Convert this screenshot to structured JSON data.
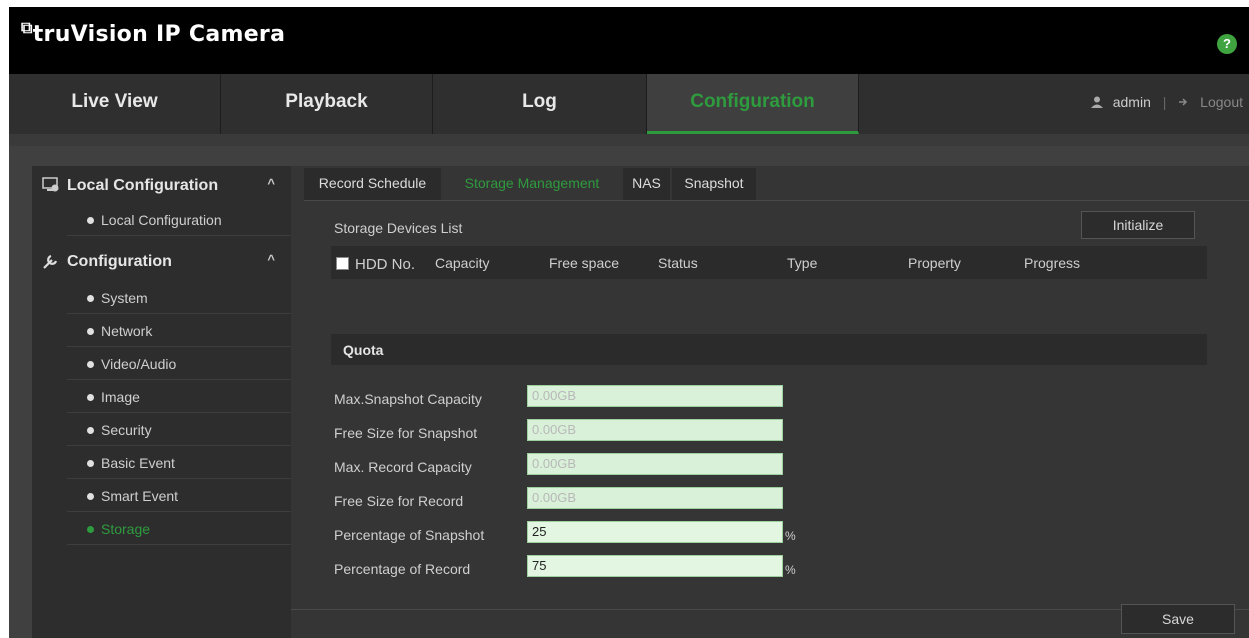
{
  "header": {
    "brand_mark": "⧉",
    "brand": "truVision IP Camera",
    "help_icon": "?"
  },
  "nav": {
    "tabs": [
      {
        "label": "Live View"
      },
      {
        "label": "Playback"
      },
      {
        "label": "Log"
      },
      {
        "label": "Configuration",
        "active": true
      }
    ],
    "user": "admin",
    "separator": "|",
    "logout": "Logout"
  },
  "sidebar": {
    "local_section": {
      "label": "Local Configuration",
      "caret": "^",
      "items": [
        {
          "label": "Local Configuration"
        }
      ]
    },
    "config_section": {
      "label": "Configuration",
      "caret": "^",
      "items": [
        {
          "label": "System"
        },
        {
          "label": "Network"
        },
        {
          "label": "Video/Audio"
        },
        {
          "label": "Image"
        },
        {
          "label": "Security"
        },
        {
          "label": "Basic Event"
        },
        {
          "label": "Smart Event"
        },
        {
          "label": "Storage",
          "active": true
        }
      ]
    }
  },
  "tabs": [
    {
      "label": "Record Schedule"
    },
    {
      "label": "Storage Management",
      "active": true
    },
    {
      "label": "NAS"
    },
    {
      "label": "Snapshot"
    }
  ],
  "storage": {
    "title": "Storage Devices List",
    "initialize_label": "Initialize",
    "columns": {
      "hdd": "HDD No.",
      "capacity": "Capacity",
      "free": "Free space",
      "status": "Status",
      "type": "Type",
      "property": "Property",
      "progress": "Progress"
    }
  },
  "quota": {
    "title": "Quota",
    "fields": [
      {
        "label": "Max.Snapshot Capacity",
        "value": "0.00GB",
        "editable": false
      },
      {
        "label": "Free Size for Snapshot",
        "value": "0.00GB",
        "editable": false
      },
      {
        "label": "Max. Record Capacity",
        "value": "0.00GB",
        "editable": false
      },
      {
        "label": "Free Size for Record",
        "value": "0.00GB",
        "editable": false
      },
      {
        "label": "Percentage of Snapshot",
        "value": "25",
        "editable": true,
        "unit": "%"
      },
      {
        "label": "Percentage of Record",
        "value": "75",
        "editable": true,
        "unit": "%"
      }
    ]
  },
  "save_label": "Save",
  "colors": {
    "accent": "#2e9b3e",
    "background": "#404040"
  }
}
